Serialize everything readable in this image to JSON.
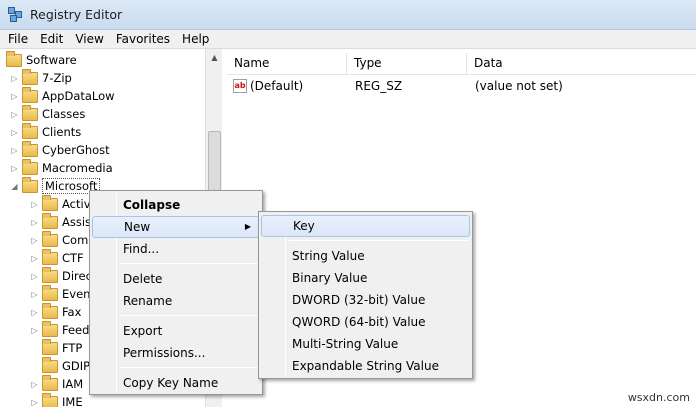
{
  "window": {
    "title": "Registry Editor"
  },
  "menubar": [
    "File",
    "Edit",
    "View",
    "Favorites",
    "Help"
  ],
  "tree": {
    "items": [
      {
        "label": "Software",
        "level": 0,
        "expander": ""
      },
      {
        "label": "7-Zip",
        "level": 1,
        "expander": "▷"
      },
      {
        "label": "AppDataLow",
        "level": 1,
        "expander": "▷"
      },
      {
        "label": "Classes",
        "level": 1,
        "expander": "▷"
      },
      {
        "label": "Clients",
        "level": 1,
        "expander": "▷"
      },
      {
        "label": "CyberGhost",
        "level": 1,
        "expander": "▷"
      },
      {
        "label": "Macromedia",
        "level": 1,
        "expander": "▷"
      },
      {
        "label": "Microsoft",
        "level": 1,
        "expander": "◢"
      },
      {
        "label": "Activ",
        "level": 2,
        "expander": "▷"
      },
      {
        "label": "Assis",
        "level": 2,
        "expander": "▷"
      },
      {
        "label": "Com",
        "level": 2,
        "expander": "▷"
      },
      {
        "label": "CTF",
        "level": 2,
        "expander": "▷"
      },
      {
        "label": "Direc",
        "level": 2,
        "expander": "▷"
      },
      {
        "label": "Even",
        "level": 2,
        "expander": "▷"
      },
      {
        "label": "Fax",
        "level": 2,
        "expander": "▷"
      },
      {
        "label": "Feed",
        "level": 2,
        "expander": "▷"
      },
      {
        "label": "FTP",
        "level": 2,
        "expander": ""
      },
      {
        "label": "GDIP",
        "level": 2,
        "expander": ""
      },
      {
        "label": "IAM",
        "level": 2,
        "expander": "▷"
      },
      {
        "label": "IME",
        "level": 2,
        "expander": "▷"
      }
    ]
  },
  "list": {
    "columns": [
      "Name",
      "Type",
      "Data"
    ],
    "rows": [
      {
        "icon": "ab",
        "name": "(Default)",
        "type": "REG_SZ",
        "data": "(value not set)"
      }
    ]
  },
  "context_menu": {
    "items": [
      "Collapse",
      "New",
      "Find...",
      "Delete",
      "Rename",
      "Export",
      "Permissions...",
      "Copy Key Name"
    ]
  },
  "submenu": {
    "items": [
      "Key",
      "String Value",
      "Binary Value",
      "DWORD (32-bit) Value",
      "QWORD (64-bit) Value",
      "Multi-String Value",
      "Expandable String Value"
    ]
  },
  "watermark": "wsxdn.com"
}
